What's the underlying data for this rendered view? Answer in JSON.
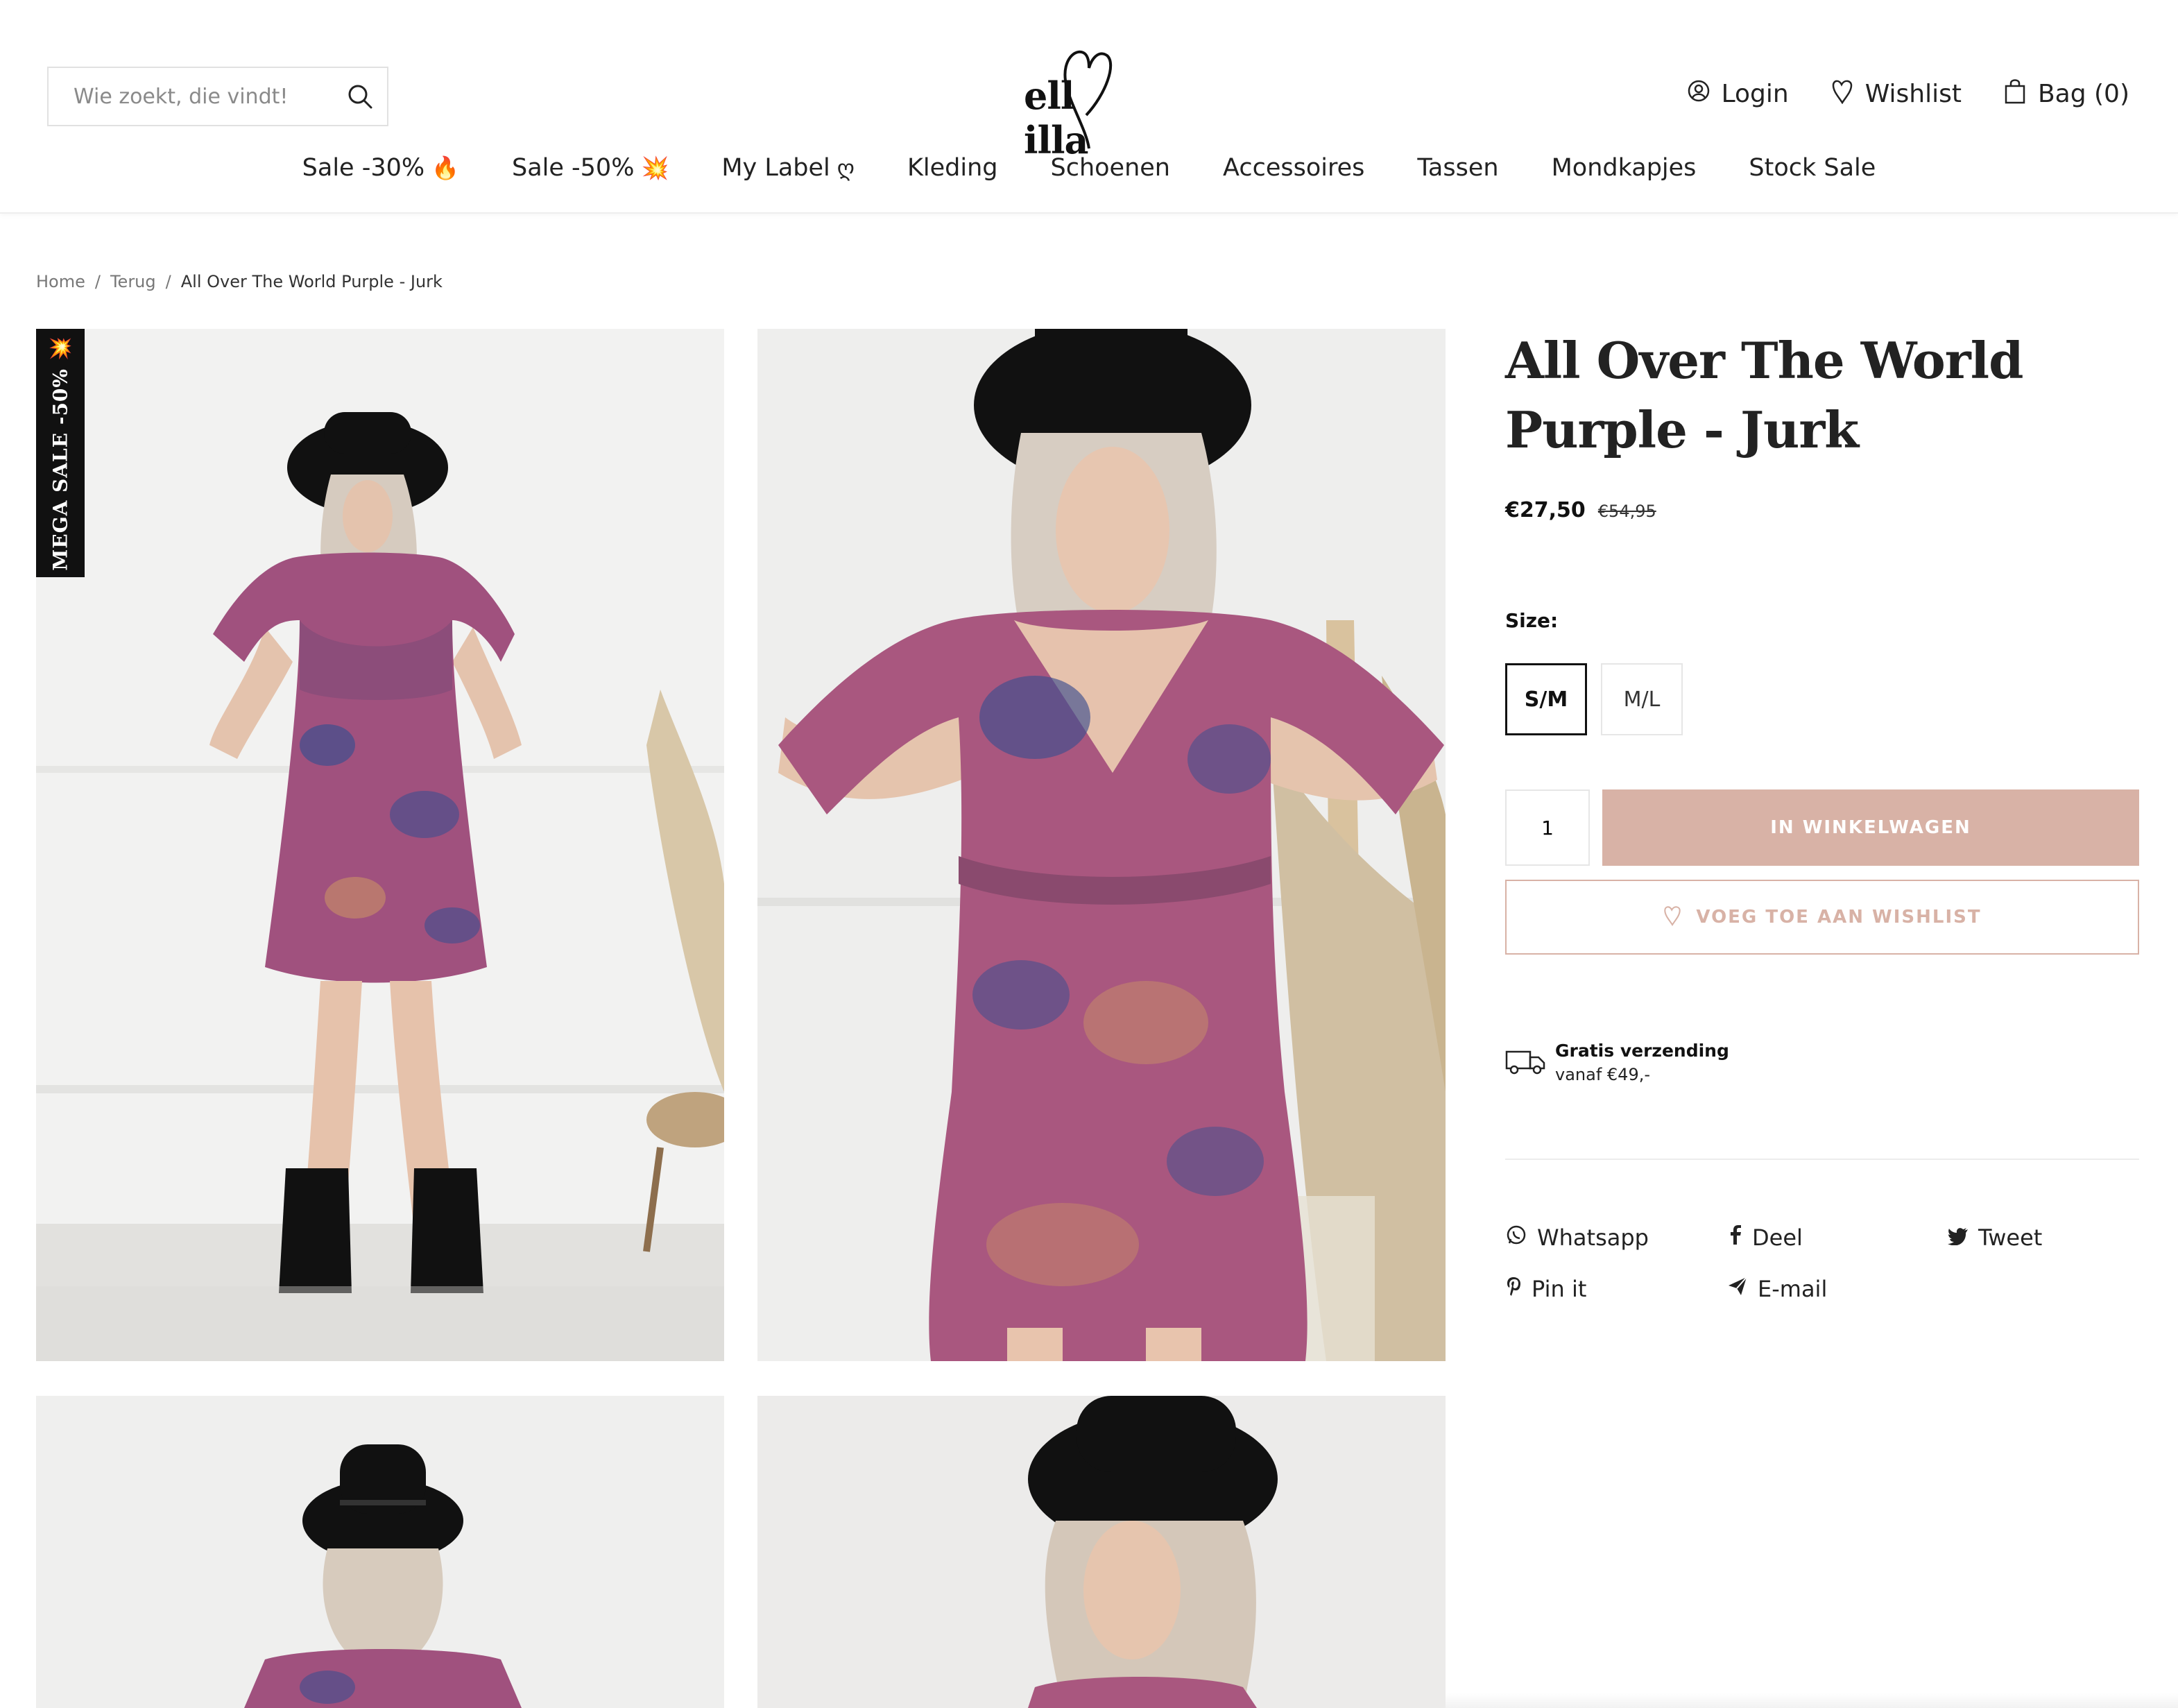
{
  "search": {
    "placeholder": "Wie zoekt, die vindt!"
  },
  "logo": {
    "text": "ell illa"
  },
  "account_nav": {
    "login": "Login",
    "wishlist": "Wishlist",
    "bag": "Bag (0)"
  },
  "main_nav": [
    {
      "label": "Sale -30%",
      "emoji": "🔥"
    },
    {
      "label": "Sale -50%",
      "emoji": "💥"
    },
    {
      "label": "My Label",
      "emoji": "ღ"
    },
    {
      "label": "Kleding",
      "emoji": ""
    },
    {
      "label": "Schoenen",
      "emoji": ""
    },
    {
      "label": "Accessoires",
      "emoji": ""
    },
    {
      "label": "Tassen",
      "emoji": ""
    },
    {
      "label": "Mondkapjes",
      "emoji": ""
    },
    {
      "label": "Stock Sale",
      "emoji": ""
    }
  ],
  "breadcrumb": {
    "home": "Home",
    "sep": "/",
    "back": "Terug",
    "current": "All Over The World Purple - Jurk"
  },
  "badge": {
    "text": "MEGA SALE -50% 💥"
  },
  "product": {
    "title": "All Over The World Purple - Jurk",
    "price_now": "€27,50",
    "price_old": "€54,95",
    "size_label": "Size:",
    "sizes": [
      {
        "label": "S/M",
        "selected": true
      },
      {
        "label": "M/L",
        "selected": false
      }
    ],
    "quantity": "1",
    "add_to_cart": "IN WINKELWAGEN",
    "add_to_wishlist": "VOEG TOE AAN WISHLIST"
  },
  "shipping": {
    "title": "Gratis verzending",
    "subtitle": "vanaf €49,-"
  },
  "share": {
    "whatsapp": "Whatsapp",
    "facebook": "Deel",
    "twitter": "Tweet",
    "pinterest": "Pin it",
    "email": "E-mail"
  },
  "colors": {
    "accent": "#d8b2a6",
    "text": "#222222",
    "badge_bg": "#111111",
    "dress_purple": "#a0517e",
    "dress_blue": "#3e4f8f"
  },
  "icons": {
    "search": "search-icon",
    "login": "user-icon",
    "wishlist": "heart-icon",
    "bag": "shopping-bag-icon",
    "shipping": "truck-icon",
    "whatsapp": "whatsapp-icon",
    "facebook": "facebook-icon",
    "twitter": "twitter-icon",
    "pinterest": "pinterest-icon",
    "email": "send-icon"
  }
}
